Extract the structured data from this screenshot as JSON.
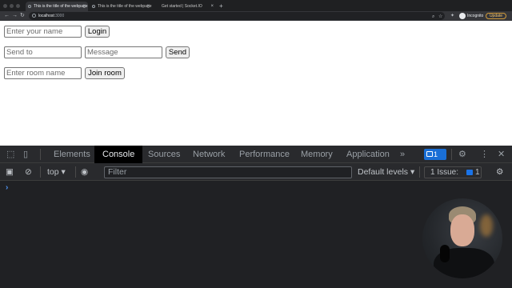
{
  "browser": {
    "tabs": [
      {
        "title": "This is the title of the webpage",
        "active": true
      },
      {
        "title": "This is the title of the webpage",
        "active": false
      },
      {
        "title": "Get started | Socket.IO",
        "active": false
      }
    ],
    "new_tab": "+",
    "address": {
      "host": "localhost",
      "port": ":3000"
    },
    "profile_label": "Incognito",
    "update_label": "Update"
  },
  "page": {
    "login": {
      "name_placeholder": "Enter your name",
      "button": "Login"
    },
    "send": {
      "to_placeholder": "Send to",
      "message_placeholder": "Message",
      "button": "Send"
    },
    "room": {
      "room_placeholder": "Enter room name",
      "button": "Join room"
    }
  },
  "devtools": {
    "tabs": [
      "Elements",
      "Console",
      "Sources",
      "Network",
      "Performance",
      "Memory",
      "Application"
    ],
    "active_tab": "Console",
    "more_tabs": "»",
    "messages_count": "1",
    "context": "top",
    "filter_placeholder": "Filter",
    "levels": "Default levels",
    "issues_label": "1 Issue:",
    "issues_count": "1",
    "prompt": "›"
  },
  "colors": {
    "accent": "#1a73e8",
    "update_border": "#d09a3a",
    "prompt": "#4f93f0",
    "devtools_bg": "#202124"
  }
}
